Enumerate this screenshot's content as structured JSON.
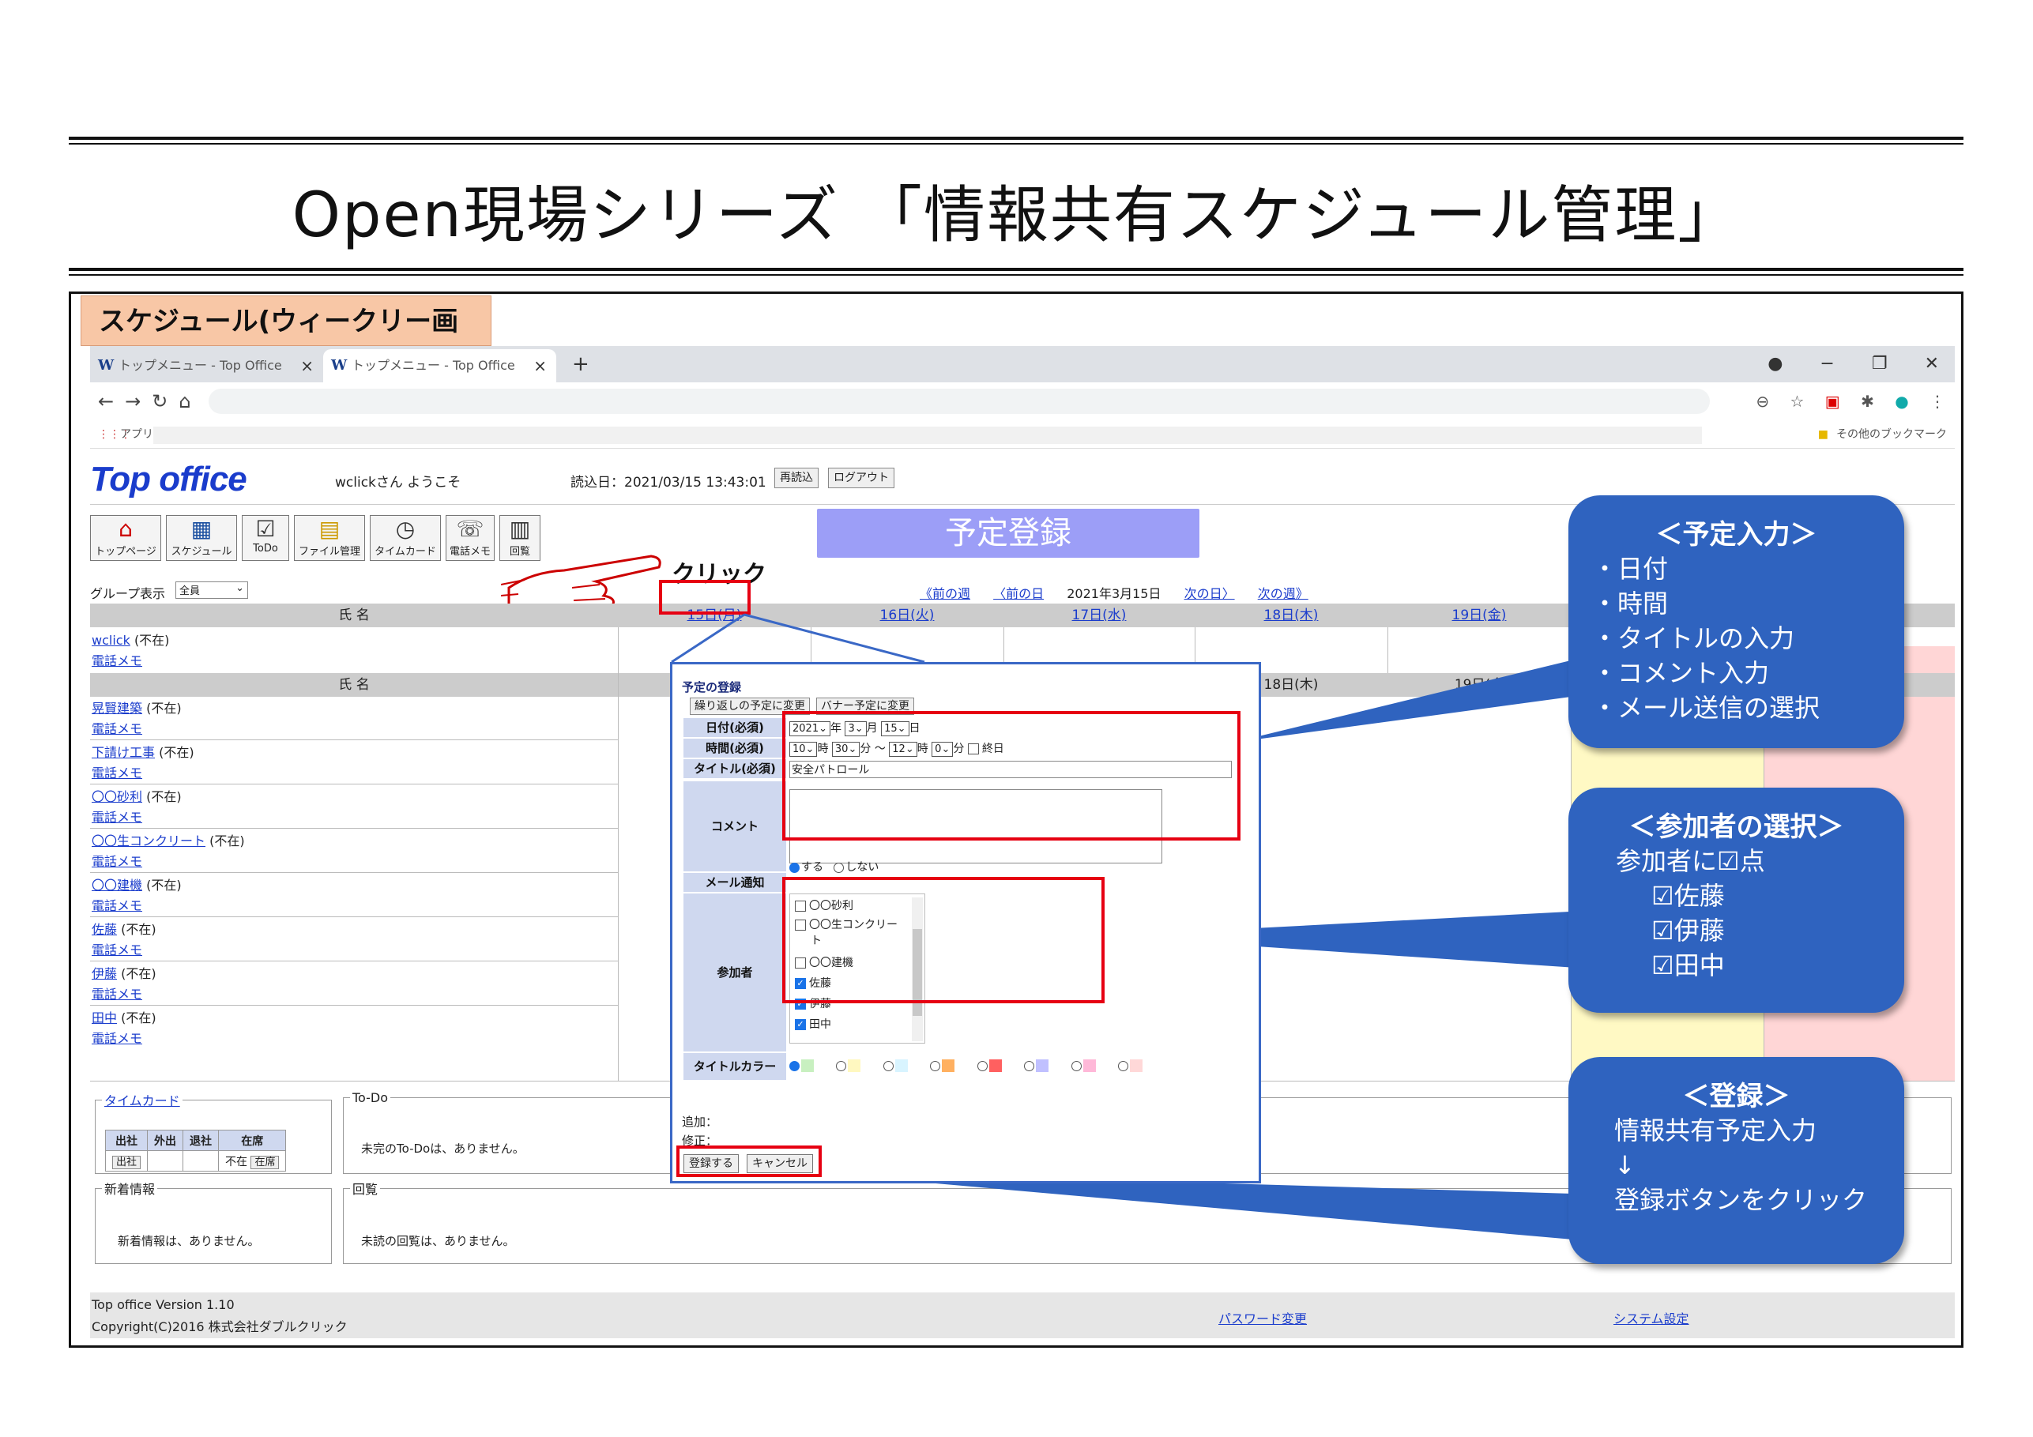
{
  "slide": {
    "title": "Open現場シリーズ 「情報共有スケジュール管理」",
    "section_label": "スケジュール(ウィークリー画面)"
  },
  "browser": {
    "tabs": [
      "トップメニュー - Top Office",
      "トップメニュー - Top Office"
    ],
    "tab_icon_text": "W",
    "new_tab": "+",
    "apps_label": "アプリ",
    "other_bookmarks": "その他のブックマーク",
    "window_controls": [
      "−",
      "❐",
      "✕"
    ]
  },
  "app": {
    "logo": "Top office",
    "welcome": "wclickさん ようこそ",
    "read_time": "読込日：2021/03/15 13:43:01",
    "reload_button": "再読込",
    "logout_button": "ログアウト",
    "toolbar": [
      {
        "label": "トップページ",
        "icon": "home-icon",
        "glyph": "⌂"
      },
      {
        "label": "スケジュール",
        "icon": "calendar-icon",
        "glyph": "▦"
      },
      {
        "label": "ToDo",
        "icon": "checkbox-icon",
        "glyph": "☑"
      },
      {
        "label": "ファイル管理",
        "icon": "file-icon",
        "glyph": "▤"
      },
      {
        "label": "タイムカード",
        "icon": "clock-icon",
        "glyph": "◷"
      },
      {
        "label": "電話メモ",
        "icon": "phone-icon",
        "glyph": "☏"
      },
      {
        "label": "回覧",
        "icon": "document-icon",
        "glyph": "▥"
      }
    ],
    "page_header": "予定登録",
    "group_label": "グループ表示",
    "group_value": "全員",
    "week_nav": {
      "prev_week": "《前の週",
      "prev_day": "〈前の日",
      "current": "2021年3月15日",
      "next_day": "次の日〉",
      "next_week": "次の週》"
    },
    "click_label": "クリック",
    "name_header": "氏 名",
    "days": [
      "15日(月)",
      "16日(火)",
      "17日(水)",
      "18日(木)",
      "19日(金)"
    ],
    "second_header_day": "18日(木)",
    "second_header_day2": "19日(金",
    "self_row": {
      "name": "wclick",
      "status": "(不在)",
      "memo": "電話メモ"
    },
    "people": [
      {
        "name": "晃賢建築",
        "status": "(不在)",
        "memo": "電話メモ"
      },
      {
        "name": "下請け工事",
        "status": "(不在)",
        "memo": "電話メモ"
      },
      {
        "name": "〇〇砂利",
        "status": "(不在)",
        "memo": "電話メモ"
      },
      {
        "name": "〇〇生コンクリート",
        "status": "(不在)",
        "memo": "電話メモ"
      },
      {
        "name": "〇〇建機",
        "status": "(不在)",
        "memo": "電話メモ"
      },
      {
        "name": "佐藤",
        "status": "(不在)",
        "memo": "電話メモ"
      },
      {
        "name": "伊藤",
        "status": "(不在)",
        "memo": "電話メモ"
      },
      {
        "name": "田中",
        "status": "(不在)",
        "memo": "電話メモ"
      }
    ],
    "timecard": {
      "legend": "タイムカード",
      "headers": [
        "出社",
        "外出",
        "退社",
        "在席"
      ],
      "btn_in": "出社",
      "absent": "不在",
      "btn_present": "在席"
    },
    "news": {
      "legend": "新着情報",
      "text": "新着情報は、ありません。"
    },
    "todo": {
      "legend": "To-Do",
      "text": "未完のTo-Doは、ありません。"
    },
    "circular": {
      "legend": "回覧",
      "text": "未読の回覧は、ありません。"
    },
    "footer": {
      "version": "Top office Version 1.10",
      "copyright": "Copyright(C)2016 株式会社ダブルクリック",
      "password_link": "パスワード変更",
      "settings_link": "システム設定"
    }
  },
  "dialog": {
    "title": "予定の登録",
    "tab_repeat": "繰り返しの予定に変更",
    "tab_banner": "バナー予定に変更",
    "date_label": "日付(必須)",
    "date": {
      "year": "2021",
      "year_suffix": "年",
      "month": "3",
      "month_suffix": "月",
      "day": "15",
      "day_suffix": "日"
    },
    "time_label": "時間(必須)",
    "time": {
      "start_hour": "10",
      "h1": "時",
      "start_min": "30",
      "m1": "分",
      "sep": "～",
      "end_hour": "12",
      "h2": "時",
      "end_min": "0",
      "m2": "分",
      "allday": "終日"
    },
    "title_label": "タイトル(必須)",
    "title_value": "安全パトロール",
    "comment_label": "コメント",
    "mail_label": "メール通知",
    "mail_yes": "する",
    "mail_no": "しない",
    "participants_label": "参加者",
    "participants": [
      {
        "name": "〇〇砂利",
        "checked": false
      },
      {
        "name": "〇〇生コンクリー",
        "checked": false
      },
      {
        "name": "ト",
        "checked": false
      },
      {
        "name": "〇〇建機",
        "checked": false
      },
      {
        "name": "佐藤",
        "checked": true
      },
      {
        "name": "伊藤",
        "checked": true
      },
      {
        "name": "田中",
        "checked": true
      }
    ],
    "color_label": "タイトルカラー",
    "colors": [
      "#c8f0c0",
      "#fff8c0",
      "#d8f4ff",
      "#ffb060",
      "#ff6060",
      "#c0c0ff",
      "#ffb8d8",
      "#ffd8d8"
    ],
    "added_label": "追加：",
    "modified_label": "修正：",
    "register_button": "登録する",
    "cancel_button": "キャンセル"
  },
  "callouts": [
    {
      "title": "＜予定入力＞",
      "lines": [
        "・日付",
        "・時間",
        "・タイトルの入力",
        "・コメント入力",
        "・メール送信の選択"
      ]
    },
    {
      "title": "＜参加者の選択＞",
      "lines": [
        "参加者に☑点",
        "☑佐藤",
        "☑伊藤",
        "☑田中"
      ]
    },
    {
      "title": "＜登録＞",
      "lines": [
        "情報共有予定入力",
        "↓",
        "登録ボタンをクリック"
      ]
    }
  ]
}
